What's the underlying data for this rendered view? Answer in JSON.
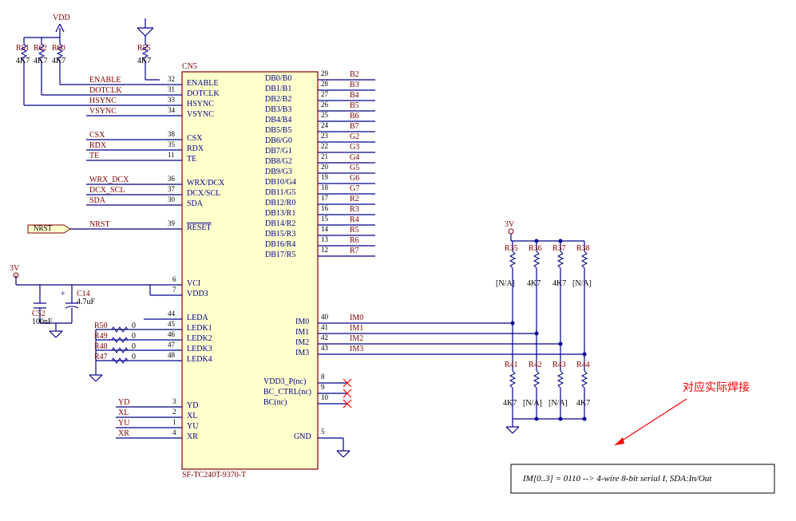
{
  "power": {
    "vdd": "VDD",
    "v3": "3V"
  },
  "port": {
    "nrst": "NRST"
  },
  "resistors_pullup": [
    {
      "ref": "R51",
      "val": "4K7"
    },
    {
      "ref": "R62",
      "val": "4K7"
    },
    {
      "ref": "R60",
      "val": "4K7"
    },
    {
      "ref": "R55",
      "val": "4K7"
    }
  ],
  "caps": [
    {
      "ref": "C52",
      "val": "100nF"
    },
    {
      "ref": "C14",
      "val": "4.7uF"
    }
  ],
  "resistors_led": [
    {
      "ref": "R50",
      "val": "0"
    },
    {
      "ref": "R49",
      "val": "0"
    },
    {
      "ref": "R48",
      "val": "0"
    },
    {
      "ref": "R47",
      "val": "0"
    }
  ],
  "ic": {
    "ref": "CN5",
    "part": "SF-TC240T-9370-T"
  },
  "pins_left": [
    {
      "net": "ENABLE",
      "num": "32",
      "name": "ENABLE"
    },
    {
      "net": "DOTCLK",
      "num": "31",
      "name": "DOTCLK"
    },
    {
      "net": "HSYNC",
      "num": "33",
      "name": "HSYNC"
    },
    {
      "net": "VSYNC",
      "num": "34",
      "name": "VSYNC"
    },
    {
      "net": "CSX",
      "num": "38",
      "name": "CSX"
    },
    {
      "net": "RDX",
      "num": "35",
      "name": "RDX"
    },
    {
      "net": "TE",
      "num": "11",
      "name": "TE"
    },
    {
      "net": "WRX_DCX",
      "num": "36",
      "name": "WRX/DCX"
    },
    {
      "net": "DCX_SCL",
      "num": "37",
      "name": "DCX/SCL"
    },
    {
      "net": "SDA",
      "num": "30",
      "name": "SDA"
    },
    {
      "net": "NRST",
      "num": "39",
      "name": "RESET",
      "over": true
    },
    {
      "net": "",
      "num": "6",
      "name": "VCI"
    },
    {
      "net": "",
      "num": "7",
      "name": "VDD3"
    },
    {
      "net": "",
      "num": "44",
      "name": "LEDA"
    },
    {
      "net": "",
      "num": "45",
      "name": "LEDK1"
    },
    {
      "net": "",
      "num": "46",
      "name": "LEDK2"
    },
    {
      "net": "",
      "num": "47",
      "name": "LEDK3"
    },
    {
      "net": "",
      "num": "48",
      "name": "LEDK4"
    },
    {
      "net": "YD",
      "num": "3",
      "name": "YD"
    },
    {
      "net": "XL",
      "num": "2",
      "name": "XL"
    },
    {
      "net": "YU",
      "num": "1",
      "name": "YU"
    },
    {
      "net": "XR",
      "num": "4",
      "name": "XR"
    }
  ],
  "pins_right": [
    {
      "name": "DB0/B0",
      "num": "29",
      "net": "B2"
    },
    {
      "name": "DB1/B1",
      "num": "28",
      "net": "B3"
    },
    {
      "name": "DB2/B2",
      "num": "27",
      "net": "B4"
    },
    {
      "name": "DB3/B3",
      "num": "26",
      "net": "B5"
    },
    {
      "name": "DB4/B4",
      "num": "25",
      "net": "B6"
    },
    {
      "name": "DB5/B5",
      "num": "24",
      "net": "B7"
    },
    {
      "name": "DB6/G0",
      "num": "23",
      "net": "G2"
    },
    {
      "name": "DB7/G1",
      "num": "22",
      "net": "G3"
    },
    {
      "name": "DB8/G2",
      "num": "21",
      "net": "G4"
    },
    {
      "name": "DB9/G3",
      "num": "20",
      "net": "G5"
    },
    {
      "name": "DB10/G4",
      "num": "19",
      "net": "G6"
    },
    {
      "name": "DB11/G5",
      "num": "18",
      "net": "G7"
    },
    {
      "name": "DB12/R0",
      "num": "17",
      "net": "R2"
    },
    {
      "name": "DB13/R1",
      "num": "16",
      "net": "R3"
    },
    {
      "name": "DB14/R2",
      "num": "15",
      "net": "R4"
    },
    {
      "name": "DB15/R3",
      "num": "14",
      "net": "R5"
    },
    {
      "name": "DB16/R4",
      "num": "13",
      "net": "R6"
    },
    {
      "name": "DB17/R5",
      "num": "12",
      "net": "R7"
    },
    {
      "name": "IM0",
      "num": "40",
      "net": "IM0"
    },
    {
      "name": "IM1",
      "num": "41",
      "net": "IM1"
    },
    {
      "name": "IM2",
      "num": "42",
      "net": "IM2"
    },
    {
      "name": "IM3",
      "num": "43",
      "net": "IM3"
    },
    {
      "name": "VDD3_P(nc)",
      "num": "8",
      "net": ""
    },
    {
      "name": "BC_CTRL(nc)",
      "num": "9",
      "net": ""
    },
    {
      "name": "BC(nc)",
      "num": "10",
      "net": ""
    },
    {
      "name": "GND",
      "num": "5",
      "net": ""
    }
  ],
  "im_top": [
    {
      "ref": "R35",
      "val": "[N/A]"
    },
    {
      "ref": "R36",
      "val": "4K7"
    },
    {
      "ref": "R37",
      "val": "4K7"
    },
    {
      "ref": "R38",
      "val": "[N/A]"
    }
  ],
  "im_bot": [
    {
      "ref": "R41",
      "val": "4K7"
    },
    {
      "ref": "R42",
      "val": "[N/A]"
    },
    {
      "ref": "R43",
      "val": "[N/A]"
    },
    {
      "ref": "R44",
      "val": "4K7"
    }
  ],
  "annotation": "对应实际焊接",
  "note": "IM[0..3] = 0110 --> 4-wire 8-bit serial I, SDA:In/Out"
}
